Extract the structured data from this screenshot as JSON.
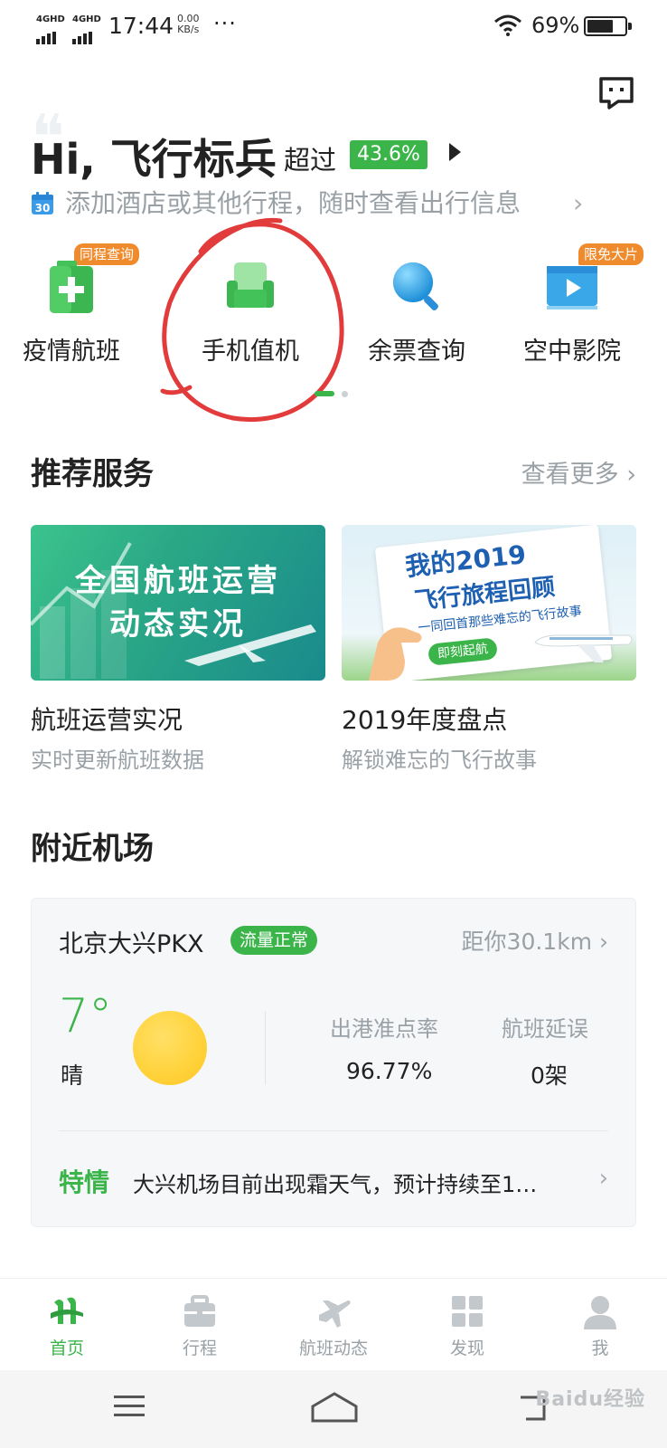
{
  "status_bar": {
    "network1": "4GHD",
    "network2": "4GHD",
    "time": "17:44",
    "speed_value": "0.00",
    "speed_unit": "KB/s",
    "more": "···",
    "battery_percent": "69%",
    "battery_level": 0.69
  },
  "header": {
    "greeting": "Hi, 飞行标兵",
    "exceed_label": "超过",
    "exceed_pct": "43.6%",
    "calendar_day": "30",
    "trip_hint": "添加酒店或其他行程，随时查看出行信息",
    "trip_chevron": "›"
  },
  "quick_actions": [
    {
      "label": "疫情航班",
      "tag": "同程查询",
      "icon": "medical-kit-icon"
    },
    {
      "label": "手机值机",
      "tag": "",
      "icon": "seat-icon"
    },
    {
      "label": "余票查询",
      "tag": "",
      "icon": "magnifier-icon"
    },
    {
      "label": "空中影院",
      "tag": "限免大片",
      "icon": "play-video-icon"
    }
  ],
  "recommend": {
    "title": "推荐服务",
    "more": "查看更多 ›",
    "cards": [
      {
        "image_line1": "全国航班运营",
        "image_line2": "动态实况",
        "title": "航班运营实况",
        "subtitle": "实时更新航班数据"
      },
      {
        "image_line1": "我的2019",
        "image_line2": "飞行旅程回顾",
        "image_line3": "一同回首那些难忘的飞行故事",
        "image_button": "即刻起航",
        "title": "2019年度盘点",
        "subtitle": "解锁难忘的飞行故事"
      }
    ]
  },
  "nearby": {
    "title": "附近机场",
    "airport_name": "北京大兴PKX",
    "traffic_badge": "流量正常",
    "distance": "距你30.1km ›",
    "temperature": "7°",
    "weather": "晴",
    "stats": [
      {
        "label": "出港准点率",
        "value": "96.77%"
      },
      {
        "label": "航班延误",
        "value": "0架"
      }
    ],
    "special_tag": "特情",
    "special_text": "大兴机场目前出现霜天气，预计持续至1…",
    "special_chevron": "›"
  },
  "tabbar": [
    {
      "label": "首页",
      "icon": "home-logo-icon",
      "active": true
    },
    {
      "label": "行程",
      "icon": "briefcase-icon",
      "active": false
    },
    {
      "label": "航班动态",
      "icon": "airplane-icon",
      "active": false
    },
    {
      "label": "发现",
      "icon": "grid-icon",
      "active": false
    },
    {
      "label": "我",
      "icon": "person-icon",
      "active": false
    }
  ],
  "watermark": "Baidu经验",
  "colors": {
    "accent": "#3bb44a",
    "tag_orange": "#f08b2d",
    "muted_text": "#9aa1a6",
    "annotation_red": "#e23b3b"
  }
}
